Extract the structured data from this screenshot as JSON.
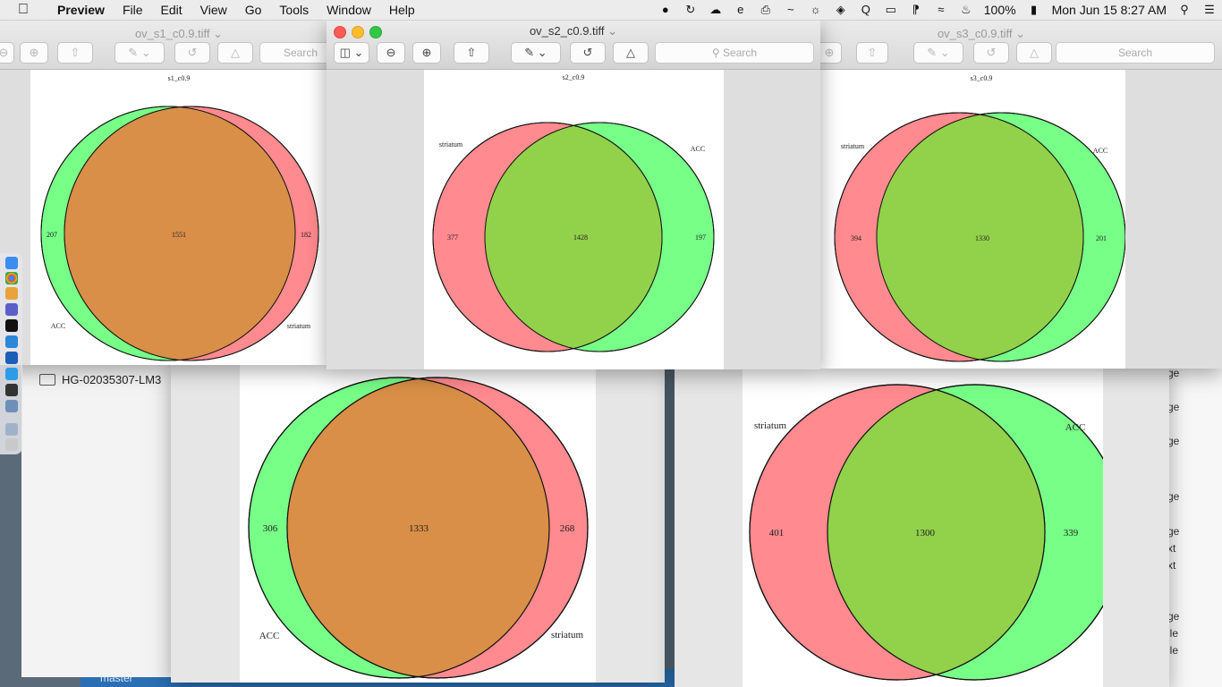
{
  "menubar": {
    "app_name": "Preview",
    "items": [
      "File",
      "Edit",
      "View",
      "Go",
      "Tools",
      "Window",
      "Help"
    ],
    "battery": "100%",
    "clock": "Mon Jun 15  8:27 AM"
  },
  "windows": {
    "s1": {
      "title": "ov_s1_c0.9.tiff",
      "search": "Search",
      "figure": {
        "title": "s1_c0.9",
        "left_label": "ACC",
        "right_label": "striatum",
        "left_only": "207",
        "overlap": "1551",
        "right_only": "182"
      }
    },
    "s2": {
      "title": "ov_s2_c0.9.tiff",
      "search": "Search",
      "figure": {
        "title": "s2_c0.9",
        "left_label": "striatum",
        "right_label": "ACC",
        "left_only": "377",
        "overlap": "1428",
        "right_only": "197"
      }
    },
    "s3": {
      "title": "ov_s3_c0.9.tiff",
      "search": "Search",
      "figure": {
        "title": "s3_c0.9",
        "left_label": "striatum",
        "right_label": "ACC",
        "left_only": "394",
        "overlap": "1330",
        "right_only": "201"
      }
    },
    "bottom_left": {
      "figure": {
        "left_label": "ACC",
        "right_label": "striatum",
        "left_only": "306",
        "overlap": "1333",
        "right_only": "268"
      }
    },
    "bottom_right": {
      "figure": {
        "left_label": "striatum",
        "right_label": "ACC",
        "left_only": "401",
        "overlap": "1300",
        "right_only": "339"
      }
    }
  },
  "finder": {
    "device": "HG-02035307-LM3"
  },
  "background_list": [
    "ge",
    "ge",
    "ge",
    "ge",
    "ge",
    "xt",
    "xt",
    "ge",
    "ile",
    "ile"
  ],
  "taskbar": {
    "branch": "master"
  },
  "colors": {
    "green": "#77ff88",
    "red": "#ff8a8f",
    "orange_overlap": "#d98f47",
    "green_overlap": "#92d14a"
  }
}
